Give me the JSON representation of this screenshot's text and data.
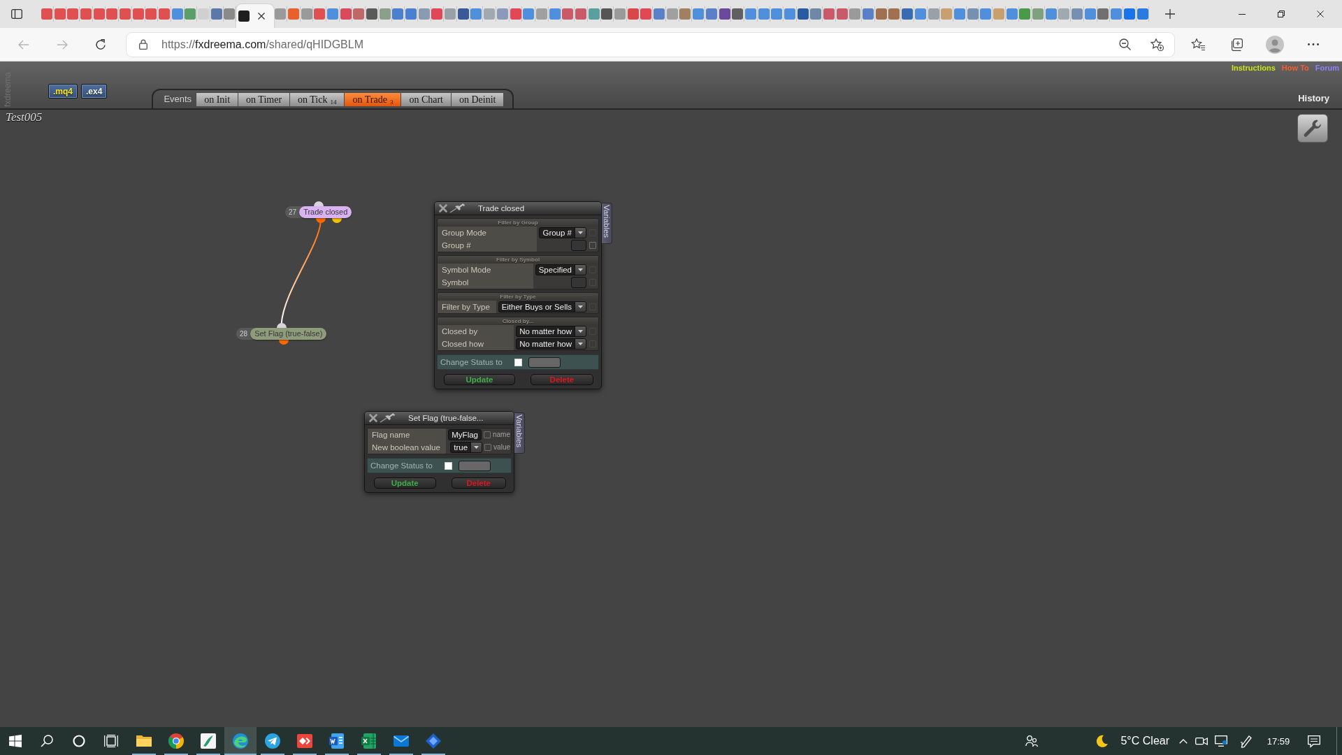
{
  "browser": {
    "tabs": [
      {
        "color": "#e05050",
        "selected": false
      },
      {
        "color": "#e05050",
        "selected": false
      },
      {
        "color": "#e05050",
        "selected": false
      },
      {
        "color": "#e05050",
        "selected": false
      },
      {
        "color": "#e05050",
        "selected": false
      },
      {
        "color": "#e05050",
        "selected": false
      },
      {
        "color": "#e05050",
        "selected": false
      },
      {
        "color": "#e05050",
        "selected": false
      },
      {
        "color": "#e05050",
        "selected": false
      },
      {
        "color": "#e05050",
        "selected": false
      },
      {
        "color": "#4f8fdc",
        "selected": false
      },
      {
        "color": "#5a9e6a",
        "selected": false
      },
      {
        "color": "#d0d0d0",
        "selected": false
      },
      {
        "color": "#5b78a8",
        "selected": false
      },
      {
        "color": "#8a8a8a",
        "selected": false
      },
      {
        "color": "#1e1e1e",
        "selected": true
      },
      {
        "color": "#9a9a9a",
        "selected": false
      },
      {
        "color": "#e8602c",
        "selected": false
      },
      {
        "color": "#9a9a9a",
        "selected": false
      },
      {
        "color": "#e05050",
        "selected": false
      },
      {
        "color": "#4f8fdc",
        "selected": false
      },
      {
        "color": "#d94a5a",
        "selected": false
      },
      {
        "color": "#c06868",
        "selected": false
      },
      {
        "color": "#5a5a5a",
        "selected": false
      },
      {
        "color": "#8aa08a",
        "selected": false
      },
      {
        "color": "#4a80d0",
        "selected": false
      },
      {
        "color": "#4a80d0",
        "selected": false
      },
      {
        "color": "#8a9ab0",
        "selected": false
      },
      {
        "color": "#e04858",
        "selected": false
      },
      {
        "color": "#9aa0a8",
        "selected": false
      },
      {
        "color": "#3b5998",
        "selected": false
      },
      {
        "color": "#4f8fdc",
        "selected": false
      },
      {
        "color": "#a0a8b0",
        "selected": false
      },
      {
        "color": "#8a9ab8",
        "selected": false
      },
      {
        "color": "#e04858",
        "selected": false
      },
      {
        "color": "#4f8fdc",
        "selected": false
      },
      {
        "color": "#a0a0a0",
        "selected": false
      },
      {
        "color": "#4f8fdc",
        "selected": false
      },
      {
        "color": "#c85a6a",
        "selected": false
      },
      {
        "color": "#c85a6a",
        "selected": false
      },
      {
        "color": "#5aa0a0",
        "selected": false
      },
      {
        "color": "#555555",
        "selected": false
      },
      {
        "color": "#9a9a9a",
        "selected": false
      },
      {
        "color": "#d84848",
        "selected": false
      },
      {
        "color": "#e04858",
        "selected": false
      },
      {
        "color": "#5a80c8",
        "selected": false
      },
      {
        "color": "#a0a0a0",
        "selected": false
      },
      {
        "color": "#a08060",
        "selected": false
      },
      {
        "color": "#4f8fdc",
        "selected": false
      },
      {
        "color": "#5a80c8",
        "selected": false
      },
      {
        "color": "#6a4a9a",
        "selected": false
      },
      {
        "color": "#606060",
        "selected": false
      },
      {
        "color": "#4f8fdc",
        "selected": false
      },
      {
        "color": "#4f8fdc",
        "selected": false
      },
      {
        "color": "#4f8fdc",
        "selected": false
      },
      {
        "color": "#4f8fdc",
        "selected": false
      },
      {
        "color": "#2a5aa0",
        "selected": false
      },
      {
        "color": "#7088a8",
        "selected": false
      },
      {
        "color": "#c85a6a",
        "selected": false
      },
      {
        "color": "#c85a6a",
        "selected": false
      },
      {
        "color": "#9a9a9a",
        "selected": false
      },
      {
        "color": "#5a80c8",
        "selected": false
      },
      {
        "color": "#a07050",
        "selected": false
      },
      {
        "color": "#a07050",
        "selected": false
      },
      {
        "color": "#3a6ab0",
        "selected": false
      },
      {
        "color": "#4f8fdc",
        "selected": false
      },
      {
        "color": "#9aa0a8",
        "selected": false
      },
      {
        "color": "#c8a070",
        "selected": false
      },
      {
        "color": "#4f8fdc",
        "selected": false
      },
      {
        "color": "#7890b0",
        "selected": false
      },
      {
        "color": "#4f8fdc",
        "selected": false
      },
      {
        "color": "#c8a070",
        "selected": false
      },
      {
        "color": "#4f8fdc",
        "selected": false
      },
      {
        "color": "#4a9a4a",
        "selected": false
      },
      {
        "color": "#80a080",
        "selected": false
      },
      {
        "color": "#4f8fdc",
        "selected": false
      },
      {
        "color": "#a0a8b0",
        "selected": false
      },
      {
        "color": "#7890b0",
        "selected": false
      },
      {
        "color": "#4f8fdc",
        "selected": false
      },
      {
        "color": "#707070",
        "selected": false
      },
      {
        "color": "#4f8fdc",
        "selected": false
      },
      {
        "color": "#1a73e8",
        "selected": false
      },
      {
        "color": "#2a7ae0",
        "selected": false
      }
    ],
    "back": {
      "disabled": true
    },
    "forward": {
      "disabled": true
    },
    "url": {
      "scheme": "https://",
      "host": "fxdreema.com",
      "path": "/shared/qHIDGBLM"
    }
  },
  "page": {
    "side_label": "fxdreema",
    "downloads": [
      {
        "label": ".mq4",
        "kind": "mq4"
      },
      {
        "label": ".ex4",
        "kind": "ex4"
      }
    ],
    "events_label": "Events",
    "event_tabs": [
      {
        "label": "on Init",
        "selected": false
      },
      {
        "label": "on Timer",
        "selected": false
      },
      {
        "label": "on Tick",
        "count": "14",
        "selected": false
      },
      {
        "label": "on Trade",
        "count": "3",
        "selected": true
      },
      {
        "label": "on Chart",
        "selected": false
      },
      {
        "label": "on Deinit",
        "selected": false
      }
    ],
    "links": [
      {
        "label": "Instructions",
        "color": "#c8e614"
      },
      {
        "label": "How To",
        "color": "#ff5a2e"
      },
      {
        "label": "Forum",
        "color": "#8f80ff"
      }
    ],
    "history": "History",
    "project_name": "Test005",
    "nodes": [
      {
        "number": "27",
        "title": "Trade closed",
        "color": "#d9b2f2",
        "outputs": [
          {
            "color": "#ff6a00",
            "connected": true
          },
          {
            "color": "#f2c200",
            "connected": false
          }
        ]
      },
      {
        "number": "28",
        "title": "Set Flag (true-false)",
        "color": "#8e9c7a",
        "outputs": [
          {
            "color": "#ff6a00",
            "connected": false
          }
        ]
      }
    ],
    "panels": [
      {
        "title": "Trade closed",
        "side_tab": "Variables",
        "sections": [
          {
            "heading": "Filter by Group",
            "rows": [
              {
                "label": "Group Mode",
                "kind": "select",
                "value": "Group #",
                "checkbox": {
                  "checked": false,
                  "disabled": true
                }
              },
              {
                "label": "Group #",
                "kind": "input",
                "checkbox": {
                  "checked": false,
                  "disabled": false
                }
              }
            ]
          },
          {
            "heading": "Filter by Symbol",
            "rows": [
              {
                "label": "Symbol Mode",
                "kind": "select",
                "value": "Specified",
                "checkbox": {
                  "checked": false,
                  "disabled": true
                }
              },
              {
                "label": "Symbol",
                "kind": "input",
                "checkbox": {
                  "checked": false,
                  "disabled": true
                }
              }
            ]
          },
          {
            "heading": "Filter by Type",
            "rows": [
              {
                "label": "Filter by Type",
                "kind": "select",
                "value": "Either Buys or Sells",
                "checkbox": {
                  "checked": false,
                  "disabled": true
                }
              }
            ]
          },
          {
            "heading": "Closed by...",
            "rows": [
              {
                "label": "Closed by",
                "kind": "select",
                "value": "No matter how",
                "checkbox": {
                  "checked": false,
                  "disabled": true
                }
              },
              {
                "label": "Closed how",
                "kind": "select",
                "value": "No matter how",
                "checkbox": {
                  "checked": false,
                  "disabled": true
                }
              }
            ]
          }
        ],
        "status": {
          "label": "Change Status to",
          "checked": false
        },
        "buttons": [
          {
            "label": "Update",
            "kind": "update"
          },
          {
            "label": "Delete",
            "kind": "delete"
          }
        ]
      },
      {
        "title": "Set Flag (true-false...",
        "side_tab": "Variables",
        "sections": [
          {
            "rows": [
              {
                "label": "Flag name",
                "kind": "input",
                "value": "MyFlag",
                "checkbox": {
                  "checked": false,
                  "disabled": false,
                  "label": "name"
                }
              },
              {
                "label": "New boolean value",
                "kind": "select",
                "value": "true",
                "checkbox": {
                  "checked": false,
                  "disabled": false,
                  "label": "value"
                }
              }
            ]
          }
        ],
        "status": {
          "label": "Change Status to",
          "checked": false
        },
        "buttons": [
          {
            "label": "Update",
            "kind": "update"
          },
          {
            "label": "Delete",
            "kind": "delete"
          }
        ]
      }
    ]
  },
  "taskbar": {
    "apps": [
      {
        "open": true,
        "selected": false
      },
      {
        "open": true,
        "selected": false
      },
      {
        "open": true,
        "selected": false
      },
      {
        "open": true,
        "selected": true
      },
      {
        "open": true,
        "selected": false
      },
      {
        "open": true,
        "selected": false
      },
      {
        "open": true,
        "selected": false
      },
      {
        "open": true,
        "selected": false
      },
      {
        "open": true,
        "selected": false
      },
      {
        "open": true,
        "selected": false
      }
    ],
    "weather": "5°C Clear",
    "time": "17:59"
  }
}
